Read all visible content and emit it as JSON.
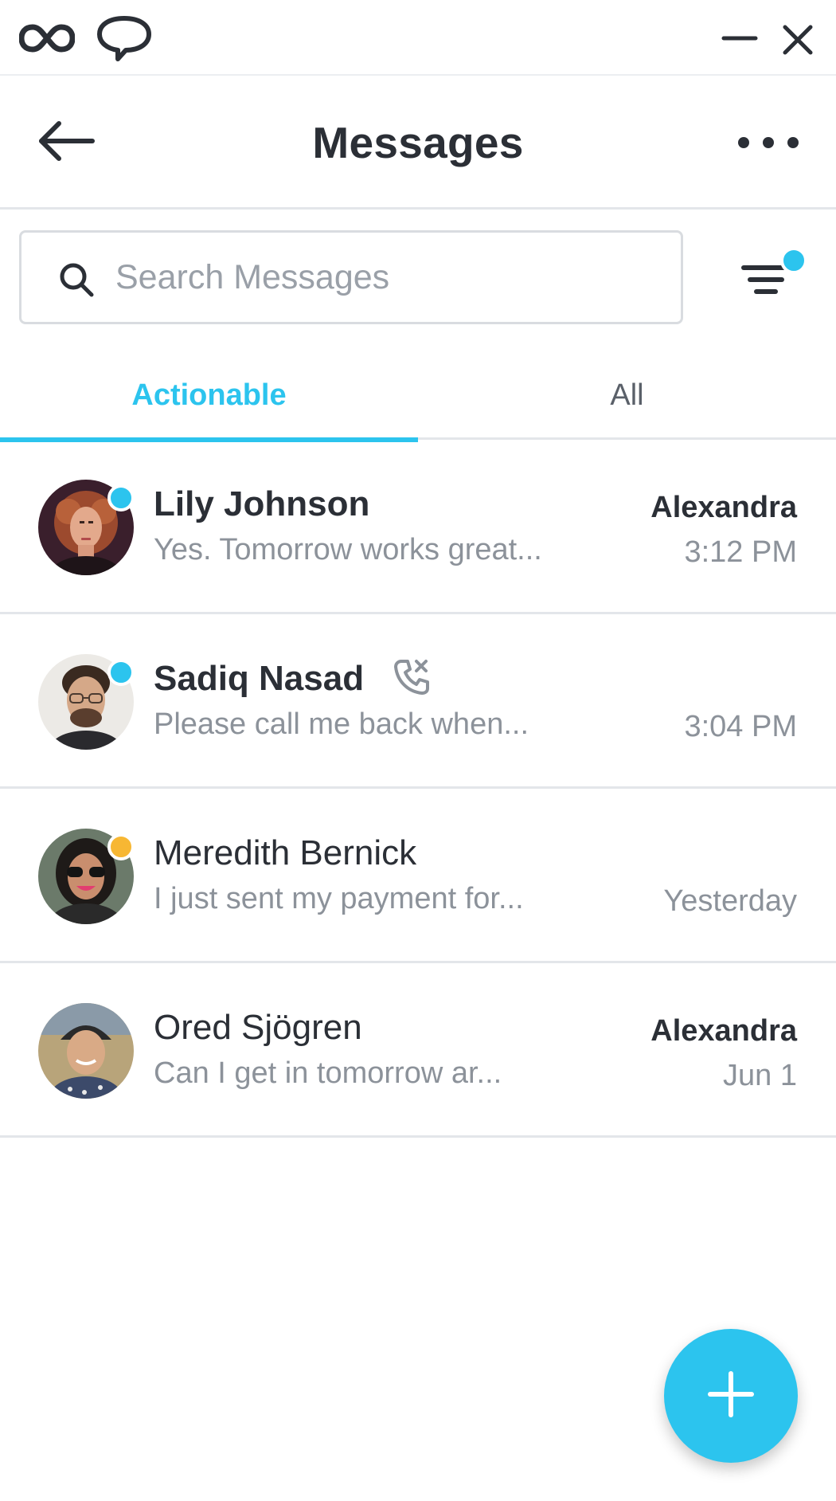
{
  "window": {
    "logo_icon": "infinity-logo-icon",
    "chat_icon": "speech-bubble-icon",
    "minimize_icon": "minimize-icon",
    "close_icon": "close-icon"
  },
  "header": {
    "back_icon": "arrow-left-icon",
    "title": "Messages",
    "more_icon": "more-horizontal-icon"
  },
  "search": {
    "placeholder": "Search Messages",
    "value": "",
    "icon": "search-icon"
  },
  "filter": {
    "icon": "filter-icon",
    "has_indicator": true
  },
  "tabs": [
    {
      "label": "Actionable",
      "active": true
    },
    {
      "label": "All",
      "active": false
    }
  ],
  "conversations": [
    {
      "name": "Lily Johnson",
      "preview": "Yes. Tomorrow works great...",
      "assignee": "Alexandra",
      "time": "3:12 PM",
      "unread": true,
      "status_color": "#2cc4ee",
      "missed_call": false
    },
    {
      "name": "Sadiq Nasad",
      "preview": "Please call me back when...",
      "assignee": "",
      "time": "3:04 PM",
      "unread": true,
      "status_color": "#2cc4ee",
      "missed_call": true
    },
    {
      "name": "Meredith Bernick",
      "preview": "I just sent my payment for...",
      "assignee": "",
      "time": "Yesterday",
      "unread": false,
      "status_color": "#f7b733",
      "missed_call": false
    },
    {
      "name": "Ored Sjögren",
      "preview": "Can I get in tomorrow ar...",
      "assignee": "Alexandra",
      "time": "Jun 1",
      "unread": false,
      "status_color": "",
      "missed_call": false
    }
  ],
  "fab": {
    "icon": "plus-icon"
  },
  "colors": {
    "accent": "#2cc4ee",
    "away": "#f7b733",
    "text": "#2b2f36",
    "muted": "#8c929a"
  }
}
